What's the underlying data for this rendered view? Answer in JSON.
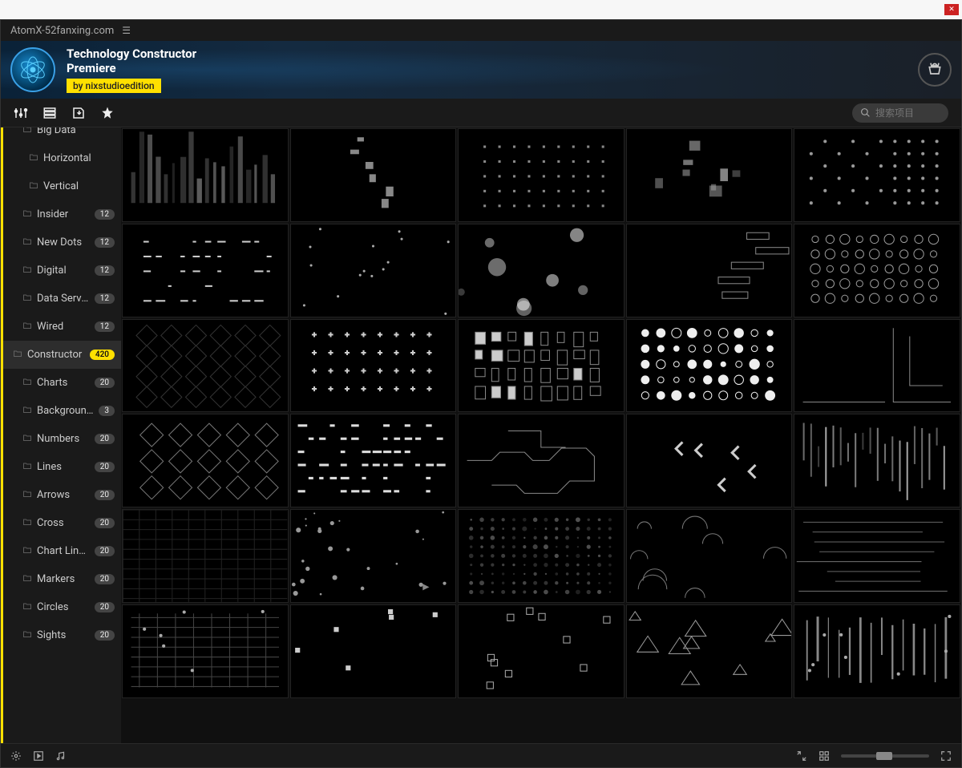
{
  "addressbar": {
    "text": "AtomX-52fanxing.com"
  },
  "header": {
    "title_line1": "Technology Constructor",
    "title_line2": "Premiere",
    "author_prefix": "by ",
    "author": "nixstudioedition"
  },
  "search": {
    "placeholder": "搜索项目"
  },
  "sidebar": {
    "items": [
      {
        "label": "Big Data",
        "count": "",
        "level": 1,
        "hl": true,
        "partial_top": true
      },
      {
        "label": "Horizontal",
        "count": "",
        "level": 2
      },
      {
        "label": "Vertical",
        "count": "",
        "level": 2
      },
      {
        "label": "Insider",
        "count": "12",
        "level": 1
      },
      {
        "label": "New Dots",
        "count": "12",
        "level": 1
      },
      {
        "label": "Digital",
        "count": "12",
        "level": 1
      },
      {
        "label": "Data Server",
        "count": "12",
        "level": 1
      },
      {
        "label": "Wired",
        "count": "12",
        "level": 1
      },
      {
        "label": "Constructor",
        "count": "420",
        "level": 0,
        "hl": true,
        "selected": true
      },
      {
        "label": "Charts",
        "count": "20",
        "level": 1
      },
      {
        "label": "Backgrounds",
        "count": "3",
        "level": 1
      },
      {
        "label": "Numbers",
        "count": "20",
        "level": 1
      },
      {
        "label": "Lines",
        "count": "20",
        "level": 1
      },
      {
        "label": "Arrows",
        "count": "20",
        "level": 1
      },
      {
        "label": "Cross",
        "count": "20",
        "level": 1
      },
      {
        "label": "Chart Lines",
        "count": "20",
        "level": 1
      },
      {
        "label": "Markers",
        "count": "20",
        "level": 1
      },
      {
        "label": "Circles",
        "count": "20",
        "level": 1
      },
      {
        "label": "Sights",
        "count": "20",
        "level": 1,
        "partial_bottom": true
      }
    ]
  },
  "grid": {
    "thumbnails": [
      "vbars",
      "glitch-bars",
      "dot-grid",
      "square-glow",
      "dot-cluster",
      "dash-lines",
      "sparse-dots",
      "bokeh",
      "wire-boxes",
      "circle-outline",
      "diamonds-dark",
      "plus-marks",
      "rect-rows",
      "circle-fill",
      "corner-lines",
      "diamonds",
      "dash-rows",
      "circuit",
      "chevrons",
      "vglitch",
      "grid-faint",
      "rand-dots",
      "dot-matrix",
      "arcs",
      "hlines",
      "grid-lines",
      "sparse-squares",
      "squares-outline",
      "triangles",
      "vlines-dots"
    ]
  }
}
